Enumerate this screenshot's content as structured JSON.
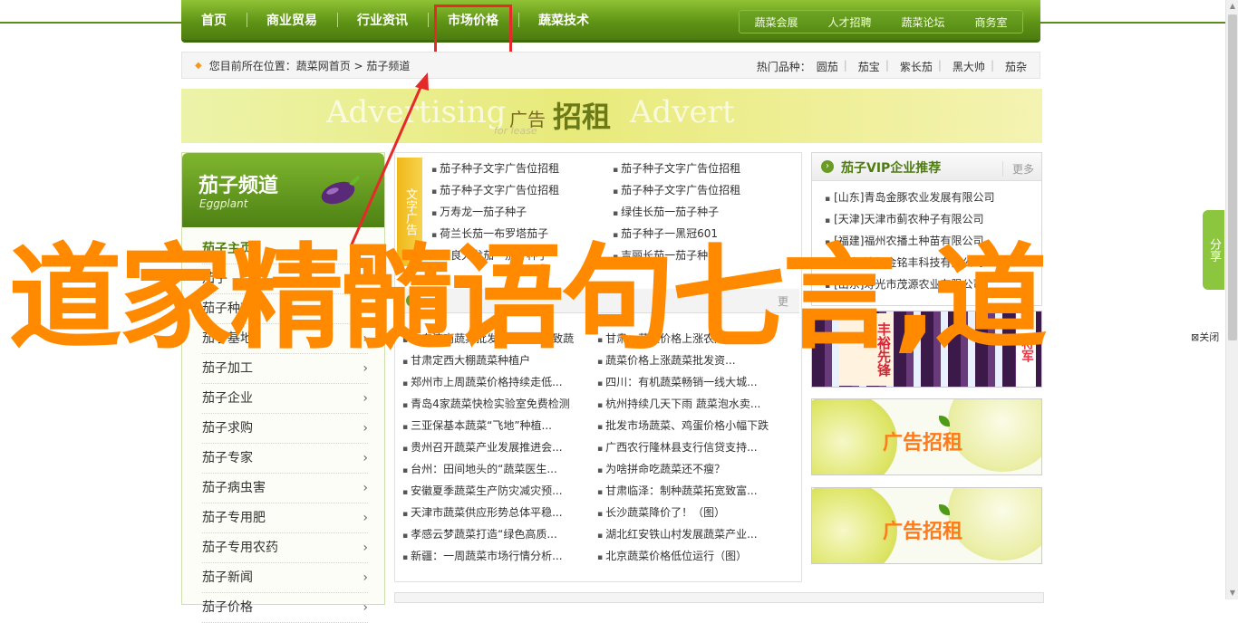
{
  "nav": {
    "items": [
      "首页",
      "商业贸易",
      "行业资讯",
      "市场价格",
      "蔬菜技术"
    ],
    "sub": [
      "蔬菜会展",
      "人才招聘",
      "蔬菜论坛",
      "商务室"
    ]
  },
  "breadcrumb": {
    "label": "您目前所在位置：",
    "path": "蔬菜网首页 > 茄子频道",
    "hot_label": "热门品种：",
    "hot": [
      "圆茄",
      "茄宝",
      "紫长茄",
      "黑大帅",
      "茄杂"
    ]
  },
  "banner": {
    "ghost": "Advertising",
    "small": "广告",
    "big": "招租",
    "sub": "for lease",
    "ghost2": "Advert"
  },
  "sidebar": {
    "title": "茄子频道",
    "subtitle": "Eggplant",
    "items": [
      "茄子主页",
      "茄子",
      "茄子种苗",
      "茄子基地",
      "茄子加工",
      "茄子企业",
      "茄子求购",
      "茄子专家",
      "茄子病虫害",
      "茄子专用肥",
      "茄子专用农药",
      "茄子新闻",
      "茄子价格"
    ]
  },
  "text_ads": {
    "tag": "文字广告",
    "items": [
      "茄子种子文字广告位招租",
      "茄子种子文字广告位招租",
      "茄子种子文字广告位招租",
      "茄子种子文字广告位招租",
      "万寿龙一茄子种子",
      "绿佳长茄一茄子种子",
      "荷兰长茄一布罗塔茄子",
      "茄子种子一黑冠601",
      "改良大龙茄 - 茄子种子",
      "吉丽长茄一茄子种子"
    ]
  },
  "news": {
    "more": "更",
    "items": [
      "山东济南蔬菜批发市场铺脱销致蔬",
      "甘肃：蔬菜价格上涨农户受贫...",
      "甘肃定西大棚蔬菜种植户",
      "蔬菜价格上涨蔬菜批发资...",
      "郑州市上周蔬菜价格持续走低...",
      "四川：有机蔬菜畅销一线大城...",
      "青岛4家蔬菜快检实验室免费检测",
      "杭州持续几天下雨 蔬菜泡水卖...",
      "三亚保基本蔬菜“飞地”种植...",
      "批发市场蔬菜、鸡蛋价格小幅下跌",
      "贵州召开蔬菜产业发展推进会...",
      "广西农行隆林县支行信贷支持...",
      "台州：田间地头的“蔬菜医生...",
      "为啥拼命吃蔬菜还不瘦？",
      "安徽夏季蔬菜生产防灾减灾预...",
      "甘肃临泽：制种蔬菜拓宽致富...",
      "天津市蔬菜供应形势总体平稳...",
      "长沙蔬菜降价了！（图）",
      "孝感云梦蔬菜打造“绿色高质...",
      "湖北红安铁山村发展蔬菜产业...",
      "新疆：一周蔬菜市场行情分析...",
      "北京蔬菜价格低位运行（图）"
    ]
  },
  "vip": {
    "title": "茄子VIP企业推荐",
    "more": "更多",
    "items": [
      "[山东]青岛金豚农业发展有限公司",
      "[天津]天津市蓟农种子有限公司",
      "[福建]福州农播土种苗有限公司",
      "[辽宁]沈阳金铭丰科技有限公司",
      "[山东]寿光市茂源农业有限公司"
    ]
  },
  "right_ads": {
    "egg_label": "丰裕先锋",
    "egg_label2": "将军",
    "lemon_small": "广告",
    "lemon_big": "招租"
  },
  "share": {
    "label": "分享",
    "close": "关闭"
  },
  "overlay": {
    "text": "道家精髓语句七言,道"
  },
  "colors": {
    "nav_green": "#5f9416",
    "overlay_orange": "#ff8a00",
    "highlight_red": "#e52a2a"
  }
}
